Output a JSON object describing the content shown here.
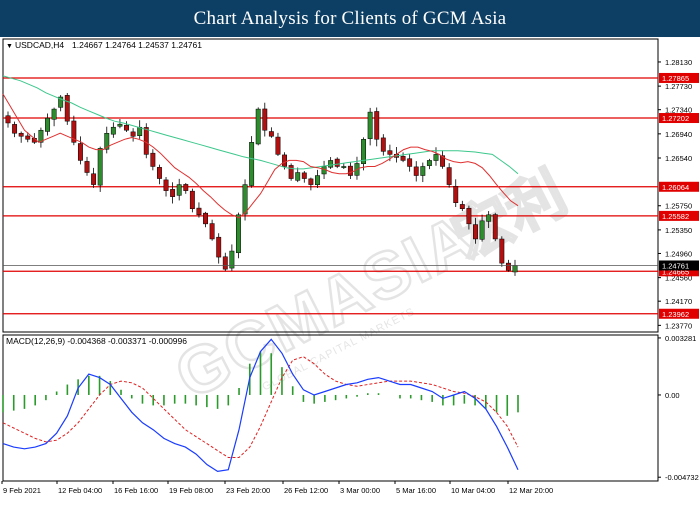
{
  "banner": {
    "title": "Chart Analysis for Clients of GCM Asia"
  },
  "watermark": {
    "brand": "GCMASIA",
    "brand_cn": "宏利",
    "sub": "GLOBAL CAPITAL MARKETS"
  },
  "colors": {
    "banner_bg": "#0d3f64",
    "bull": "#2e8b2e",
    "bear": "#b01010",
    "ma_fast": "#e03030",
    "ma_slow": "#3cc88c",
    "level": "#e00000",
    "macd_line": "#1a3cff",
    "signal_line": "#e02020",
    "histogram": "#2a9a2a"
  },
  "chart_data": [
    {
      "type": "candlestick",
      "title": "USDCAD,H4",
      "ohlc_info": "1.24667 1.24764 1.24537 1.24761",
      "open_menu_glyph": "▼",
      "ylim": [
        1.2366,
        1.2851
      ],
      "y_ticks": [
        "1.28130",
        "1.27730",
        "1.27340",
        "1.26940",
        "1.26540",
        "1.25750",
        "1.25350",
        "1.24960",
        "1.24560",
        "1.24170",
        "1.23770"
      ],
      "x_ticks": [
        "9 Feb 2021",
        "12 Feb 04:00",
        "16 Feb 16:00",
        "19 Feb 08:00",
        "23 Feb 20:00",
        "26 Feb 12:00",
        "3 Mar 00:00",
        "5 Mar 16:00",
        "10 Mar 04:00",
        "12 Mar 20:00"
      ],
      "levels": [
        {
          "value": 1.27865,
          "label": "1.27865"
        },
        {
          "value": 1.27202,
          "label": "1.27202"
        },
        {
          "value": 1.26064,
          "label": "1.26064"
        },
        {
          "value": 1.25582,
          "label": "1.25582"
        },
        {
          "value": 1.24665,
          "label": "1.24665"
        },
        {
          "value": 1.23962,
          "label": "1.23962"
        }
      ],
      "current_price": {
        "value": 1.24761,
        "label": "1.24761"
      },
      "close_path": [
        1.2712,
        1.2695,
        1.269,
        1.2685,
        1.268,
        1.27,
        1.272,
        1.2735,
        1.2755,
        1.2715,
        1.268,
        1.265,
        1.263,
        1.261,
        1.267,
        1.2695,
        1.2705,
        1.271,
        1.27,
        1.269,
        1.2705,
        1.266,
        1.264,
        1.262,
        1.26,
        1.259,
        1.261,
        1.26,
        1.257,
        1.256,
        1.2545,
        1.252,
        1.249,
        1.247,
        1.25,
        1.256,
        1.261,
        1.268,
        1.2735,
        1.27,
        1.269,
        1.266,
        1.264,
        1.262,
        1.263,
        1.262,
        1.261,
        1.2625,
        1.264,
        1.265,
        1.264,
        1.264,
        1.2625,
        1.2645,
        1.2685,
        1.273,
        1.2685,
        1.2665,
        1.266,
        1.2655,
        1.265,
        1.264,
        1.2625,
        1.264,
        1.265,
        1.266,
        1.264,
        1.261,
        1.258,
        1.257,
        1.2545,
        1.252,
        1.255,
        1.256,
        1.252,
        1.248,
        1.2468,
        1.2476
      ],
      "ma_fast": [
        1.276,
        1.274,
        1.272,
        1.27,
        1.269,
        1.268,
        1.2685,
        1.269,
        1.2695,
        1.269,
        1.2685,
        1.268,
        1.2672,
        1.2668,
        1.2668,
        1.2675,
        1.268,
        1.2685,
        1.2688,
        1.2685,
        1.268,
        1.2672,
        1.2662,
        1.265,
        1.2638,
        1.263,
        1.2622,
        1.2612,
        1.26,
        1.259,
        1.2578,
        1.2568,
        1.256,
        1.2555,
        1.2565,
        1.258,
        1.2595,
        1.2615,
        1.2635,
        1.2645,
        1.265,
        1.265,
        1.2648,
        1.264,
        1.2638,
        1.2635,
        1.263,
        1.2628,
        1.2628,
        1.2632,
        1.2638,
        1.264,
        1.264,
        1.2645,
        1.2652,
        1.266,
        1.2668,
        1.2672,
        1.2672,
        1.2668,
        1.2665,
        1.266,
        1.2652,
        1.2648,
        1.2646,
        1.2648,
        1.2645,
        1.2638,
        1.2625,
        1.261,
        1.2596,
        1.2583,
        1.2575
      ],
      "ma_slow": [
        1.279,
        1.2786,
        1.2782,
        1.2776,
        1.277,
        1.2762,
        1.2756,
        1.275,
        1.2745,
        1.2738,
        1.2732,
        1.2726,
        1.272,
        1.2715,
        1.2712,
        1.2708,
        1.2704,
        1.27,
        1.2696,
        1.2692,
        1.2688,
        1.2684,
        1.268,
        1.2676,
        1.2672,
        1.2668,
        1.2664,
        1.266,
        1.2656,
        1.2653,
        1.265,
        1.2646,
        1.2642,
        1.2638,
        1.2636,
        1.2636,
        1.2638,
        1.264,
        1.2642,
        1.2644,
        1.2646,
        1.2648,
        1.265,
        1.2652,
        1.2654,
        1.2656,
        1.2658,
        1.266,
        1.2662,
        1.2664,
        1.2666,
        1.2666,
        1.2666,
        1.2666,
        1.2665,
        1.2664,
        1.2662,
        1.266,
        1.265,
        1.264,
        1.2628
      ]
    },
    {
      "type": "macd",
      "title": "MACD(12,26,9) -0.004368 -0.003371 -0.000996",
      "ylim": [
        -0.00495,
        0.00345
      ],
      "y_ticks": [
        {
          "value": 0.003281,
          "label": "0.003281"
        },
        {
          "value": 0.0,
          "label": "0.00"
        },
        {
          "value": -0.004732,
          "label": "-0.004732"
        }
      ],
      "macd_path": [
        -0.0028,
        -0.003,
        -0.0031,
        -0.003,
        -0.0028,
        -0.0022,
        -0.0012,
        0.0004,
        0.0012,
        0.001,
        0.0006,
        -0.0002,
        -0.001,
        -0.0016,
        -0.002,
        -0.0025,
        -0.0028,
        -0.003,
        -0.0034,
        -0.004,
        -0.0044,
        -0.0043,
        -0.002,
        0.001,
        0.0025,
        0.0032,
        0.0024,
        0.0012,
        0.0003,
        0.0,
        0.0002,
        0.0004,
        0.0006,
        0.0007,
        0.0009,
        0.001,
        0.0008,
        0.0006,
        0.0006,
        0.0004,
        0.0002,
        -0.0002,
        0.0,
        0.0002,
        -0.0002,
        -0.0008,
        -0.0018,
        -0.003,
        -0.0043
      ],
      "signal_path": [
        -0.0016,
        -0.0019,
        -0.0022,
        -0.0025,
        -0.0027,
        -0.0026,
        -0.0022,
        -0.0016,
        -0.0008,
        0.0,
        0.0006,
        0.0008,
        0.0007,
        0.0004,
        -0.0002,
        -0.0008,
        -0.0014,
        -0.002,
        -0.0024,
        -0.0028,
        -0.0032,
        -0.0036,
        -0.0036,
        -0.003,
        -0.0018,
        -0.0004,
        0.001,
        0.002,
        0.0022,
        0.0018,
        0.0012,
        0.0008,
        0.0006,
        0.0005,
        0.0006,
        0.0007,
        0.0008,
        0.0008,
        0.0008,
        0.0007,
        0.0006,
        0.0004,
        0.0002,
        0.0001,
        -0.0001,
        -0.0004,
        -0.001,
        -0.0018,
        -0.003
      ],
      "histogram": [
        -0.001,
        -0.0009,
        -0.0008,
        -0.0006,
        -0.0003,
        0.0002,
        0.0006,
        0.0009,
        0.0011,
        0.0011,
        0.0008,
        0.0003,
        -0.0002,
        -0.0005,
        -0.0006,
        -0.0006,
        -0.0005,
        -0.0005,
        -0.0006,
        -0.0007,
        -0.0008,
        -0.0006,
        0.0004,
        0.0018,
        0.0025,
        0.0024,
        0.0016,
        0.0005,
        -0.0004,
        -0.0005,
        -0.0004,
        -0.0003,
        -0.0002,
        -0.0001,
        0.0001,
        0.0001,
        0.0,
        -0.0002,
        -0.0002,
        -0.0003,
        -0.0004,
        -0.0006,
        -0.0006,
        -0.0005,
        -0.0006,
        -0.0008,
        -0.001,
        -0.0012,
        -0.001
      ]
    }
  ]
}
